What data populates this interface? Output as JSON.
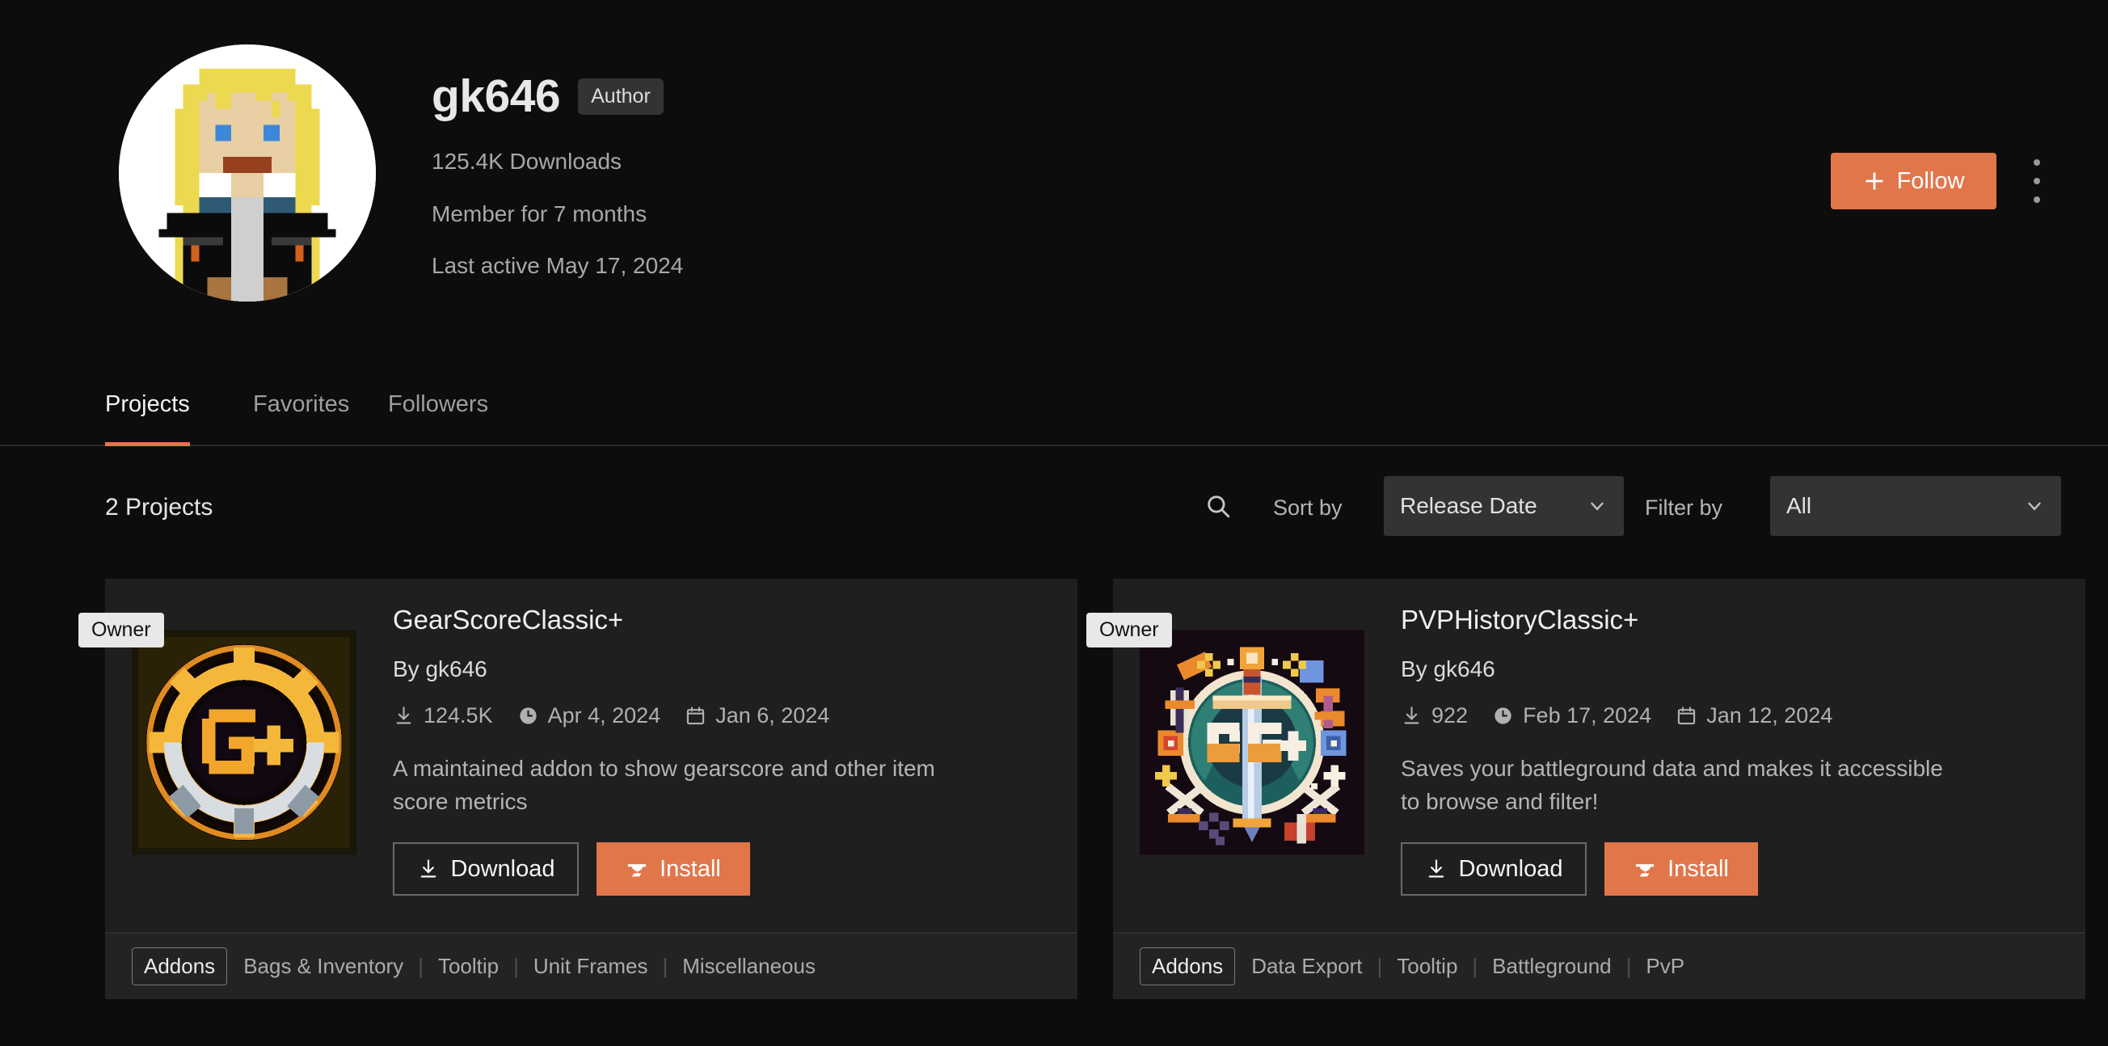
{
  "profile": {
    "username": "gk646",
    "author_badge": "Author",
    "downloads": "125.4K Downloads",
    "member_for": "Member for 7 months",
    "last_active": "Last active May 17, 2024",
    "follow_label": "Follow",
    "avatar_icon": "pixel-art-avatar",
    "plus_icon": "plus-icon",
    "more_icon": "kebab-menu-icon"
  },
  "tabs": [
    {
      "label": "Projects",
      "active": true
    },
    {
      "label": "Favorites",
      "active": false
    },
    {
      "label": "Followers",
      "active": false
    }
  ],
  "filter_bar": {
    "project_count": "2 Projects",
    "search_icon": "search-icon",
    "sort_label": "Sort by",
    "sort_value": "Release Date",
    "filter_label": "Filter by",
    "filter_value": "All",
    "chevron_icon": "chevron-down-icon"
  },
  "cards": [
    {
      "owner_badge": "Owner",
      "title": "GearScoreClassic+",
      "by_prefix": "By",
      "author": "gk646",
      "downloads": "124.5K",
      "updated": "Apr 4, 2024",
      "created": "Jan 6, 2024",
      "description": "A maintained addon to show gearscore and other item score metrics",
      "download_label": "Download",
      "install_label": "Install",
      "thumb_icon": "gearscore-gear-logo",
      "primary_tag": "Addons",
      "tags": [
        "Bags & Inventory",
        "Tooltip",
        "Unit Frames",
        "Miscellaneous"
      ]
    },
    {
      "owner_badge": "Owner",
      "title": "PVPHistoryClassic+",
      "by_prefix": "By",
      "author": "gk646",
      "downloads": "922",
      "updated": "Feb 17, 2024",
      "created": "Jan 12, 2024",
      "description": "Saves your battleground data and makes it accessible to browse and filter!",
      "download_label": "Download",
      "install_label": "Install",
      "thumb_icon": "pvphistory-sword-logo",
      "primary_tag": "Addons",
      "tags": [
        "Data Export",
        "Tooltip",
        "Battleground",
        "PvP"
      ]
    }
  ],
  "colors": {
    "page_bg": "#0d0d0d",
    "card_bg": "#1f1f1f",
    "accent": "#e2764b",
    "text_primary": "#f0f0f0",
    "text_muted": "#b0b0b0"
  }
}
